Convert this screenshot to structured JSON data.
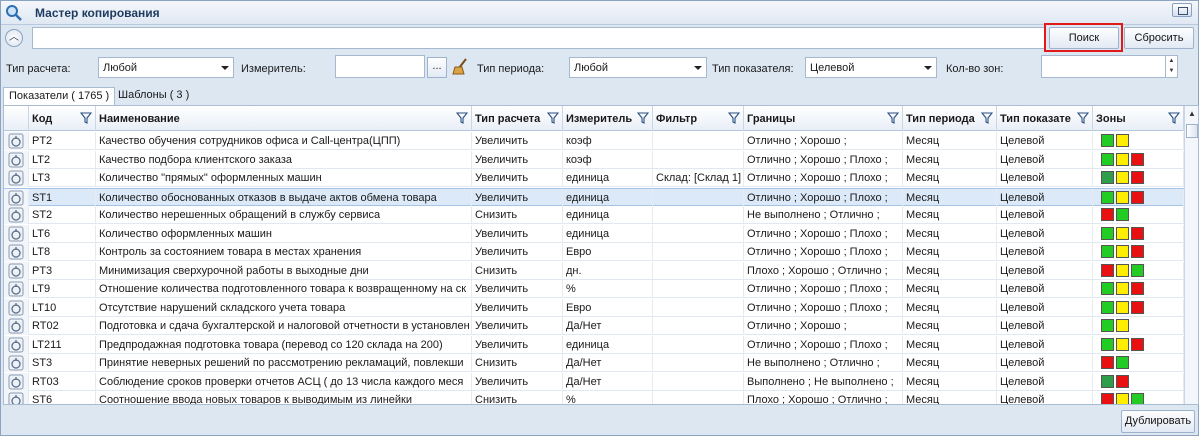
{
  "window": {
    "title": "Мастер копирования",
    "app_icon": "magnifier-icon"
  },
  "search": {
    "value": "",
    "placeholder": "",
    "search_label": "Поиск",
    "reset_label": "Сбросить"
  },
  "filters": {
    "calc_type_label": "Тип расчета:",
    "calc_type_value": "Любой",
    "meter_label": "Измеритель:",
    "meter_value": "",
    "meter_dots": "...",
    "period_type_label": "Тип периода:",
    "period_type_value": "Любой",
    "indicator_type_label": "Тип показателя:",
    "indicator_type_value": "Целевой",
    "zones_label": "Кол-во зон:",
    "zones_value": ""
  },
  "tabs": [
    {
      "label": "Показатели ( 1765 )",
      "active": true
    },
    {
      "label": "Шаблоны ( 3 )",
      "active": false
    }
  ],
  "grid": {
    "columns": [
      "Код",
      "Наименование",
      "Тип расчета",
      "Измеритель",
      "Фильтр",
      "Границы",
      "Тип периода",
      "Тип показате",
      "Зоны"
    ],
    "rows": [
      {
        "code": "PT2",
        "name": "Качество обучения сотрудников офиса и Call-центра(ЦПП)",
        "calc": "Увеличить",
        "meter": "коэф",
        "filter": "",
        "bounds": "Отлично ; Хорошо ;",
        "period": "Месяц",
        "type": "Целевой",
        "zones": [
          "g",
          "y"
        ]
      },
      {
        "code": "LT2",
        "name": "Качество подбора клиентского заказа",
        "calc": "Увеличить",
        "meter": "коэф",
        "filter": "",
        "bounds": "Отлично ; Хорошо ; Плохо ;",
        "period": "Месяц",
        "type": "Целевой",
        "zones": [
          "g",
          "y",
          "r"
        ]
      },
      {
        "code": "LT3",
        "name": "Количество \"прямых\" оформленных машин",
        "calc": "Увеличить",
        "meter": "единица",
        "filter": "Склад: [Склад 1]",
        "bounds": "Отлично ; Хорошо ; Плохо ;",
        "period": "Месяц",
        "type": "Целевой",
        "zones": [
          "dg",
          "y",
          "r"
        ]
      },
      {
        "code": "ST1",
        "name": "Количество обоснованных отказов в выдаче актов обмена товара",
        "calc": "Увеличить",
        "meter": "единица",
        "filter": "",
        "bounds": "Отлично ; Хорошо ; Плохо ;",
        "period": "Месяц",
        "type": "Целевой",
        "zones": [
          "g",
          "y",
          "r"
        ],
        "selected": true
      },
      {
        "code": "ST2",
        "name": "Количество нерешенных обращений в службу сервиса",
        "calc": "Снизить",
        "meter": "единица",
        "filter": "",
        "bounds": "Не выполнено ; Отлично ;",
        "period": "Месяц",
        "type": "Целевой",
        "zones": [
          "r",
          "g"
        ]
      },
      {
        "code": "LT6",
        "name": "Количество оформленных машин",
        "calc": "Увеличить",
        "meter": "единица",
        "filter": "",
        "bounds": "Отлично ; Хорошо ; Плохо ;",
        "period": "Месяц",
        "type": "Целевой",
        "zones": [
          "g",
          "y",
          "r"
        ]
      },
      {
        "code": "LT8",
        "name": "Контроль за состоянием товара в местах хранения",
        "calc": "Увеличить",
        "meter": "Евро",
        "filter": "",
        "bounds": "Отлично ; Хорошо ; Плохо ;",
        "period": "Месяц",
        "type": "Целевой",
        "zones": [
          "g",
          "y",
          "r"
        ]
      },
      {
        "code": "PT3",
        "name": "Минимизация сверхурочной работы в выходные дни",
        "calc": "Снизить",
        "meter": "дн.",
        "filter": "",
        "bounds": "Плохо ; Хорошо ; Отлично ;",
        "period": "Месяц",
        "type": "Целевой",
        "zones": [
          "r",
          "y",
          "g"
        ]
      },
      {
        "code": "LT9",
        "name": "Отношение количества подготовленного товара к возвращенному на ск",
        "calc": "Увеличить",
        "meter": "%",
        "filter": "",
        "bounds": "Отлично ; Хорошо ; Плохо ;",
        "period": "Месяц",
        "type": "Целевой",
        "zones": [
          "g",
          "y",
          "r"
        ]
      },
      {
        "code": "LT10",
        "name": "Отсутствие нарушений складского учета товара",
        "calc": "Увеличить",
        "meter": "Евро",
        "filter": "",
        "bounds": "Отлично ; Хорошо ; Плохо ;",
        "period": "Месяц",
        "type": "Целевой",
        "zones": [
          "g",
          "y",
          "r"
        ]
      },
      {
        "code": "RT02",
        "name": "Подготовка и сдача бухгалтерской и налоговой отчетности в установлен",
        "calc": "Увеличить",
        "meter": "Да/Нет",
        "filter": "",
        "bounds": "Отлично ; Хорошо ;",
        "period": "Месяц",
        "type": "Целевой",
        "zones": [
          "g",
          "y"
        ]
      },
      {
        "code": "LT211",
        "name": "Предпродажная подготовка товара (перевод со 120 склада на 200)",
        "calc": "Увеличить",
        "meter": "единица",
        "filter": "",
        "bounds": "Отлично ; Хорошо ; Плохо ;",
        "period": "Месяц",
        "type": "Целевой",
        "zones": [
          "g",
          "y",
          "r"
        ]
      },
      {
        "code": "ST3",
        "name": "Принятие неверных решений по рассмотрению рекламаций, повлекши",
        "calc": "Снизить",
        "meter": "Да/Нет",
        "filter": "",
        "bounds": "Не выполнено ; Отлично ;",
        "period": "Месяц",
        "type": "Целевой",
        "zones": [
          "r",
          "g"
        ]
      },
      {
        "code": "RT03",
        "name": "Соблюдение сроков проверки отчетов АСЦ  ( до 13 числа каждого меся",
        "calc": "Увеличить",
        "meter": "Да/Нет",
        "filter": "",
        "bounds": "Выполнено ; Не выполнено ;",
        "period": "Месяц",
        "type": "Целевой",
        "zones": [
          "dg",
          "r"
        ]
      },
      {
        "code": "ST6",
        "name": "Соотношение ввода новых товаров к выводимым из линейки",
        "calc": "Снизить",
        "meter": "%",
        "filter": "",
        "bounds": "Плохо ; Хорошо ; Отлично ;",
        "period": "Месяц",
        "type": "Целевой",
        "zones": [
          "r",
          "y",
          "g"
        ]
      }
    ]
  },
  "zone_colors": {
    "g": "#22cc22",
    "dg": "#2e9e4a",
    "y": "#ffee00",
    "r": "#e81010"
  },
  "footer": {
    "duplicate_label": "Дублировать"
  }
}
